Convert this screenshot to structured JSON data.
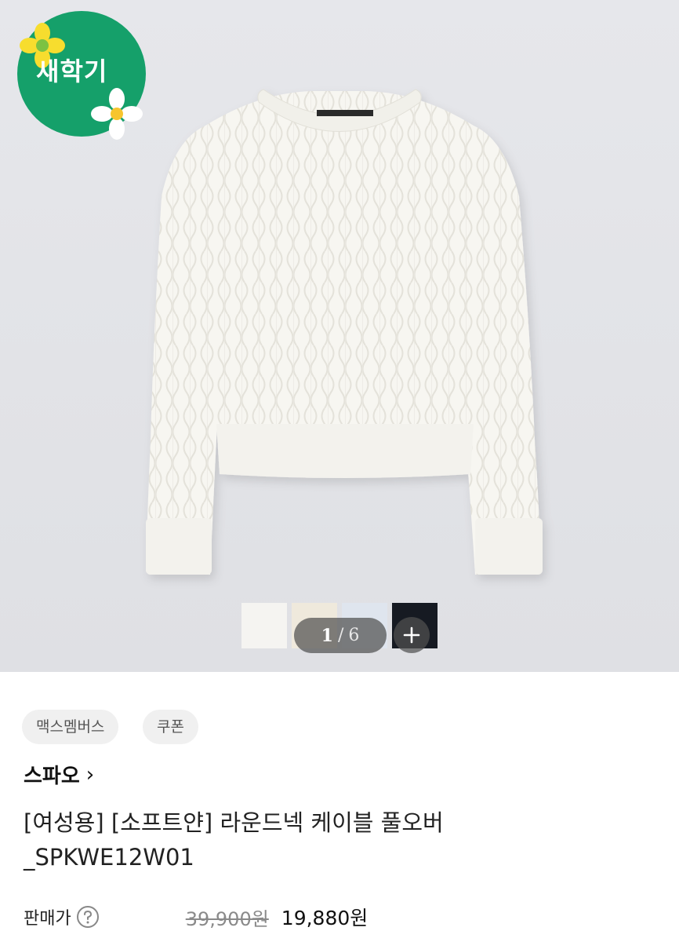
{
  "event_badge": {
    "label": "새학기"
  },
  "gallery": {
    "current": "1",
    "separator": "/",
    "total": "6",
    "swatches": [
      {
        "color": "#f5f4f1"
      },
      {
        "color": "#efe9dc"
      },
      {
        "color": "#dfe5ee"
      },
      {
        "color": "#161a22"
      }
    ]
  },
  "chips": [
    "맥스멤버스",
    "쿠폰"
  ],
  "brand": {
    "name": "스파오",
    "chevron": "›"
  },
  "product": {
    "title_line1": "[여성용] [소프트얀] 라운드넥 케이블 풀오버",
    "title_line2": "_SPKWE12W01"
  },
  "price": {
    "label": "판매가",
    "original": "39,900원",
    "sale": "19,880원"
  },
  "colors": {
    "badge_green": "#15a06a",
    "flower_yellow": "#f7dd2e"
  },
  "icons": [
    "help-icon",
    "plus-icon",
    "flower-icon",
    "chevron-right-icon"
  ]
}
